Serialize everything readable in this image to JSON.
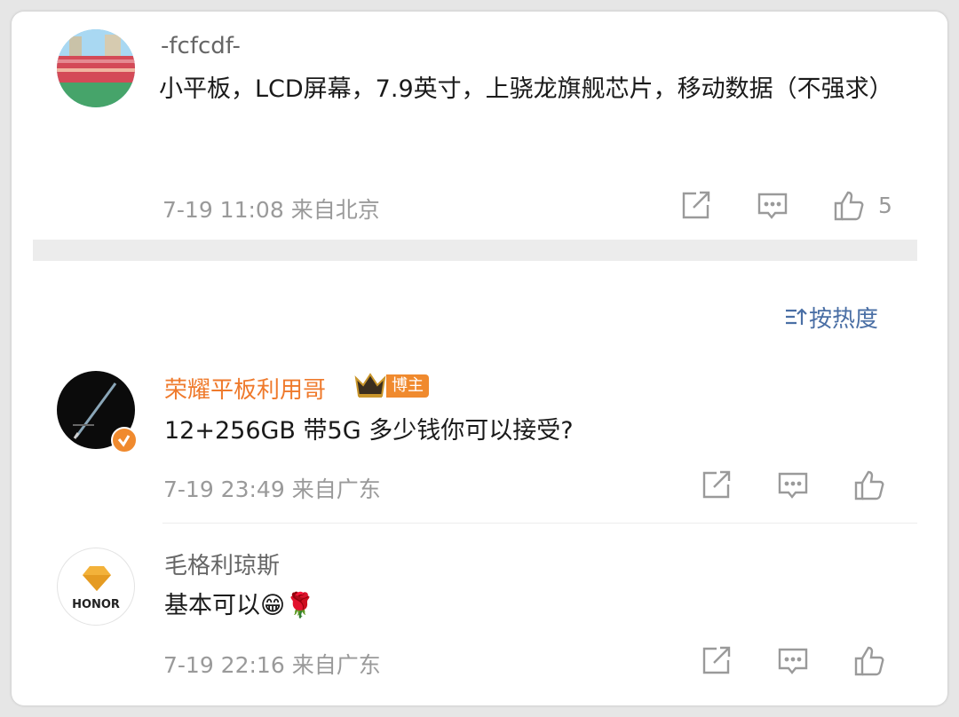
{
  "comments": [
    {
      "user": "-fcfcdf-",
      "text": "小平板，LCD屏幕，7.9英寸，上骁龙旗舰芯片，移动数据（不强求）",
      "time": "7-19 11:08",
      "location": "来自北京",
      "likes": "5"
    }
  ],
  "sort_label": "按热度",
  "replies": [
    {
      "user": "荣耀平板利用哥",
      "badge": "博主",
      "text": "12+256GB 带5G 多少钱你可以接受?",
      "time": "7-19 23:49",
      "location": "来自广东"
    },
    {
      "user": "毛格利琼斯",
      "text": "基本可以😁🌹",
      "time": "7-19 22:16",
      "location": "来自广东",
      "avatar_text": "HONOR"
    }
  ],
  "colors": {
    "blogger_name": "#ef7a2c",
    "badge": "#f08a2e",
    "sort": "#4a6fa5"
  }
}
